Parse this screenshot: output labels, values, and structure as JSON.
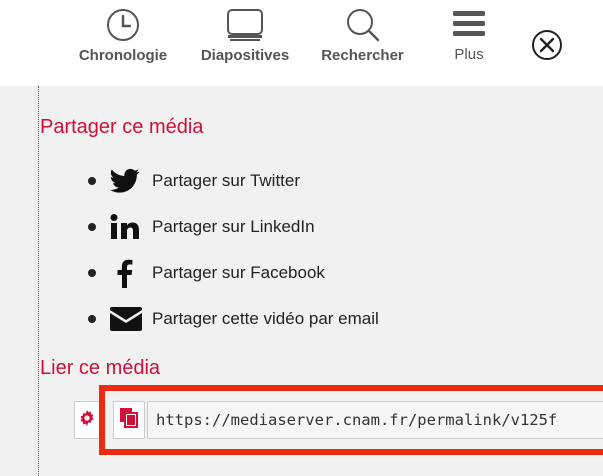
{
  "toolbar": {
    "chronologie": {
      "label": "Chronologie",
      "icon": "clock-icon"
    },
    "diapositives": {
      "label": "Diapositives",
      "icon": "monitor-icon"
    },
    "rechercher": {
      "label": "Rechercher",
      "icon": "search-icon"
    },
    "plus": {
      "label": "Plus",
      "icon": "hamburger-menu-icon"
    },
    "close": {
      "icon": "close-circle-icon"
    }
  },
  "share_section": {
    "title": "Partager ce média",
    "items": [
      {
        "label": "Partager sur Twitter",
        "icon": "twitter-icon"
      },
      {
        "label": "Partager sur LinkedIn",
        "icon": "linkedin-icon"
      },
      {
        "label": "Partager sur Facebook",
        "icon": "facebook-icon"
      },
      {
        "label": "Partager cette vidéo par email",
        "icon": "envelope-icon"
      }
    ]
  },
  "link_section": {
    "title": "Lier ce média",
    "url_value": "https://mediaserver.cnam.fr/permalink/v125f",
    "settings_icon": "gear-icon",
    "copy_icon": "copy-icon"
  },
  "colors": {
    "accent": "#d0103a",
    "highlight": "#ee2a12",
    "panel_bg": "#f1f1f1",
    "toolbar_icon": "#555555"
  }
}
